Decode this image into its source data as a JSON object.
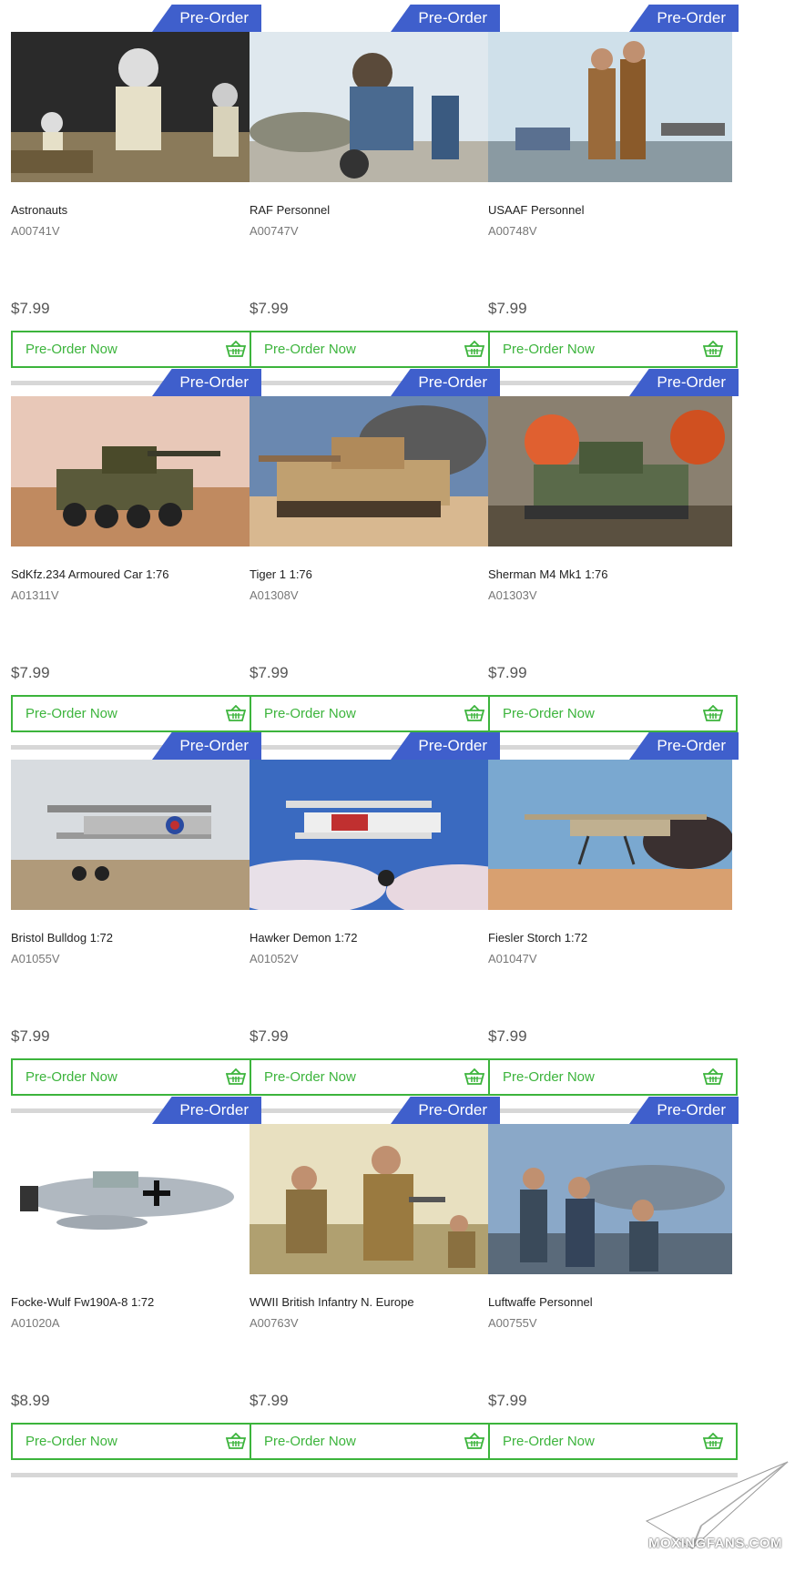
{
  "badge_label": "Pre-Order",
  "button_label": "Pre-Order Now",
  "colors": {
    "badge": "#3f5fcc",
    "button": "#3cb43c",
    "price": "#555555"
  },
  "products": [
    {
      "title": "Astronauts",
      "sku": "A00741V",
      "price": "$7.99"
    },
    {
      "title": "RAF Personnel",
      "sku": "A00747V",
      "price": "$7.99"
    },
    {
      "title": "USAAF Personnel",
      "sku": "A00748V",
      "price": "$7.99"
    },
    {
      "title": "SdKfz.234 Armoured Car 1:76",
      "sku": "A01311V",
      "price": "$7.99"
    },
    {
      "title": "Tiger 1 1:76",
      "sku": "A01308V",
      "price": "$7.99"
    },
    {
      "title": "Sherman M4 Mk1 1:76",
      "sku": "A01303V",
      "price": "$7.99"
    },
    {
      "title": "Bristol Bulldog 1:72",
      "sku": "A01055V",
      "price": "$7.99"
    },
    {
      "title": "Hawker Demon 1:72",
      "sku": "A01052V",
      "price": "$7.99"
    },
    {
      "title": "Fiesler Storch 1:72",
      "sku": "A01047V",
      "price": "$7.99"
    },
    {
      "title": "Focke-Wulf Fw190A-8 1:72",
      "sku": "A01020A",
      "price": "$8.99"
    },
    {
      "title": "WWII British Infantry N. Europe",
      "sku": "A00763V",
      "price": "$7.99"
    },
    {
      "title": "Luftwaffe Personnel",
      "sku": "A00755V",
      "price": "$7.99"
    }
  ],
  "watermark": "MOXINGFANS.COM"
}
